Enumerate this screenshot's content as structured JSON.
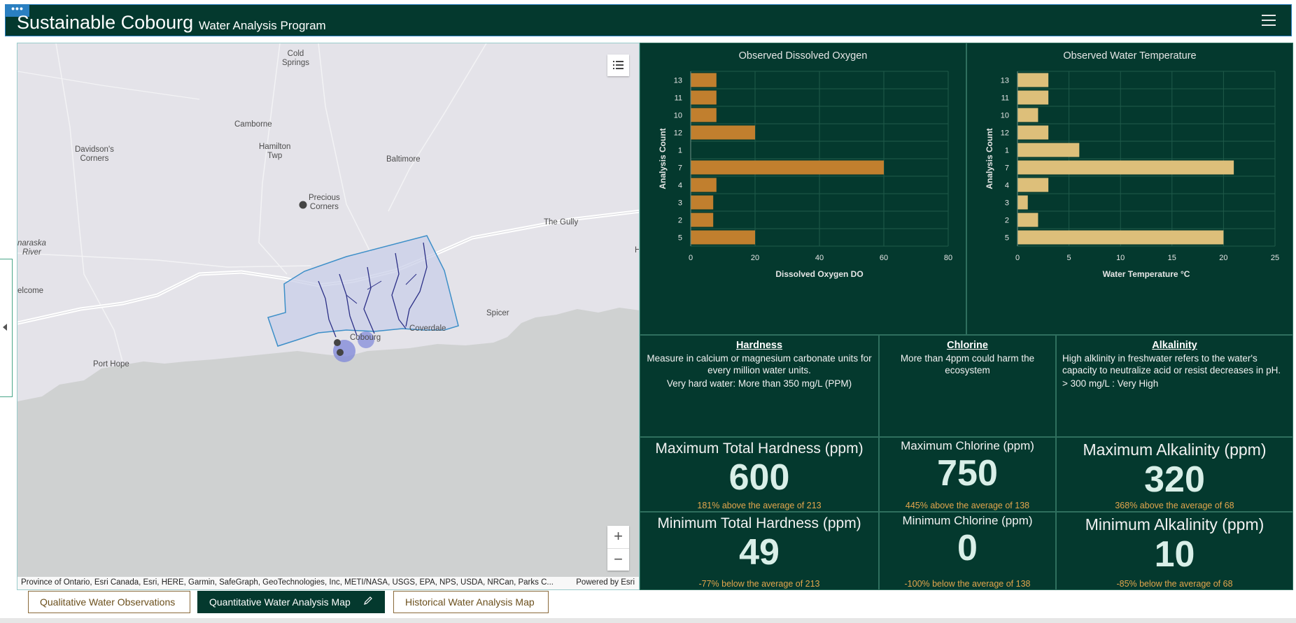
{
  "header": {
    "menu_dots": "•••",
    "title": "Sustainable Cobourg",
    "subtitle": "Water Analysis Program",
    "menu_icon": "hamburger-icon"
  },
  "map": {
    "places": [
      {
        "name": "Cold\nSprings"
      },
      {
        "name": "Camborne"
      },
      {
        "name": "Davidson's\nCorners"
      },
      {
        "name": "Hamilton\nTwp"
      },
      {
        "name": "Baltimore"
      },
      {
        "name": "Precious\nCorners"
      },
      {
        "name": "The Gully"
      },
      {
        "name": "naraska\nRiver"
      },
      {
        "name": "elcome"
      },
      {
        "name": "Spicer"
      },
      {
        "name": "Coverdale"
      },
      {
        "name": "Cobourg"
      },
      {
        "name": "Port Hope"
      },
      {
        "name": "H"
      }
    ],
    "zoom_in": "+",
    "zoom_out": "−",
    "legend_icon": "legend-list-icon",
    "attribution": "Province of Ontario, Esri Canada, Esri, HERE, Garmin, SafeGraph, GeoTechnologies, Inc, METI/NASA, USGS, EPA, NPS, USDA, NRCan, Parks C...",
    "powered_by": "Powered by Esri"
  },
  "charts": {
    "oxygen_title": "Observed Dissolved Oxygen",
    "temperature_title": "Observed Water Temperature"
  },
  "chart_data": [
    {
      "type": "bar",
      "orientation": "horizontal",
      "title": "Observed Dissolved Oxygen",
      "categories": [
        "13",
        "11",
        "10",
        "12",
        "1",
        "7",
        "4",
        "3",
        "2",
        "5"
      ],
      "values": [
        8,
        8,
        8,
        20,
        0,
        60,
        8,
        7,
        7,
        20
      ],
      "xlabel": "Dissolved Oxygen DO",
      "ylabel": "Analysis Count",
      "xlim": [
        0,
        80
      ],
      "xticks": [
        0,
        20,
        40,
        60,
        80
      ],
      "color": "#c17f2e",
      "grid": true
    },
    {
      "type": "bar",
      "orientation": "horizontal",
      "title": "Observed Water Temperature",
      "categories": [
        "13",
        "11",
        "10",
        "12",
        "1",
        "7",
        "4",
        "3",
        "2",
        "5"
      ],
      "values": [
        3,
        3,
        2,
        3,
        6,
        21,
        3,
        1,
        2,
        20
      ],
      "xlabel": "Water Temperature °C",
      "ylabel": "Analysis Count",
      "xlim": [
        0,
        25
      ],
      "xticks": [
        0,
        5,
        10,
        15,
        20,
        25
      ],
      "color": "#ddbf7a",
      "grid": true
    }
  ],
  "info": {
    "hardness": {
      "title": "Hardness",
      "text1": "Measure in calcium or magnesium carbonate units for every million water units.",
      "text2": "Very hard water: More than 350 mg/L (PPM)"
    },
    "chlorine": {
      "title": "Chlorine",
      "text1": "More than 4ppm could harm the ecosystem"
    },
    "alkalinity": {
      "title": "Alkalinity",
      "text1": "High alklinity in freshwater refers to the water's capacity to neutralize acid or resist decreases in pH.",
      "text2": "> 300 mg/L : Very High"
    }
  },
  "kpis": {
    "max_hardness": {
      "title": "Maximum Total Hardness (ppm)",
      "value": "600",
      "sub": "181% above the average of 213"
    },
    "max_chlorine": {
      "title": "Maximum Chlorine (ppm)",
      "value": "750",
      "sub": "445% above the average of 138"
    },
    "max_alkalinity": {
      "title": "Maximum Alkalinity (ppm)",
      "value": "320",
      "sub": "368% above the average of 68"
    },
    "min_hardness": {
      "title": "Minimum Total Hardness (ppm)",
      "value": "49",
      "sub": "-77% below the average of 213"
    },
    "min_chlorine": {
      "title": "Minimum Chlorine (ppm)",
      "value": "0",
      "sub": "-100% below the average of 138"
    },
    "min_alkalinity": {
      "title": "Minimum Alkalinity (ppm)",
      "value": "10",
      "sub": "-85% below the average of 68"
    }
  },
  "tabs": [
    {
      "label": "Qualitative Water Observations",
      "active": false
    },
    {
      "label": "Quantitative Water Analysis Map",
      "active": true
    },
    {
      "label": "Historical Water Analysis Map",
      "active": false
    }
  ],
  "colors": {
    "panel_bg": "#04392e",
    "accent_orange": "#c17f2e",
    "accent_tan": "#ddbf7a",
    "kpi_sub": "#e3a64d",
    "header_border": "#2a7fc1"
  }
}
